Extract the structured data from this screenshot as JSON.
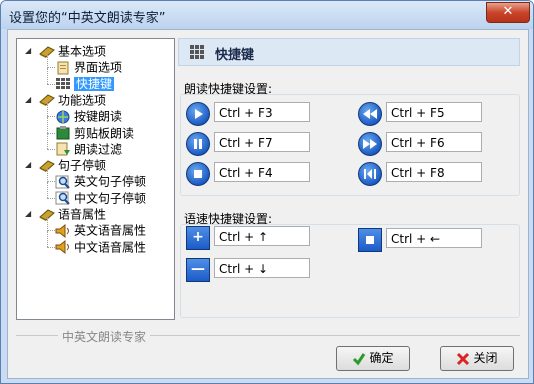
{
  "window": {
    "title": "设置您的“中英文朗读专家”",
    "close_label": "✕"
  },
  "tree": {
    "items": [
      {
        "label": "基本选项",
        "level": 0,
        "icon": "book-icon"
      },
      {
        "label": "界面选项",
        "level": 1,
        "icon": "page-icon"
      },
      {
        "label": "快捷键",
        "level": 1,
        "icon": "keyboard-icon",
        "selected": true
      },
      {
        "label": "功能选项",
        "level": 0,
        "icon": "book-icon"
      },
      {
        "label": "按键朗读",
        "level": 1,
        "icon": "globe-icon"
      },
      {
        "label": "剪贴板朗读",
        "level": 1,
        "icon": "clipboard-icon"
      },
      {
        "label": "朗读过滤",
        "level": 1,
        "icon": "filter-icon"
      },
      {
        "label": "句子停顿",
        "level": 0,
        "icon": "book-icon"
      },
      {
        "label": "英文句子停顿",
        "level": 1,
        "icon": "magnifier-icon"
      },
      {
        "label": "中文句子停顿",
        "level": 1,
        "icon": "magnifier-icon"
      },
      {
        "label": "语音属性",
        "level": 0,
        "icon": "book-icon"
      },
      {
        "label": "英文语音属性",
        "level": 1,
        "icon": "speaker-icon"
      },
      {
        "label": "中文语音属性",
        "level": 1,
        "icon": "speaker-icon"
      }
    ]
  },
  "panel": {
    "title": "快捷键",
    "read_section": "朗读快捷键设置:",
    "read_shortcuts": {
      "play": "Ctrl + F3",
      "pause": "Ctrl + F7",
      "stop": "Ctrl + F4",
      "rewind": "Ctrl + F5",
      "forward": "Ctrl + F6",
      "restart": "Ctrl + F8"
    },
    "speed_section": "语速快捷键设置:",
    "speed_shortcuts": {
      "plus_symbol": "+",
      "minus_symbol": "—",
      "faster": "Ctrl + ↑",
      "slower": "Ctrl + ↓",
      "reset": "Ctrl + ←"
    }
  },
  "footer": {
    "legend": "中英文朗读专家",
    "ok_label": "确定",
    "cancel_label": "关闭"
  }
}
